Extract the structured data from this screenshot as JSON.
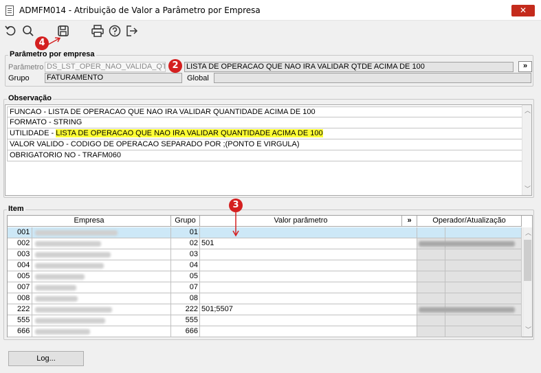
{
  "window": {
    "title": "ADMFM014 - Atribuição de Valor a Parâmetro por Empresa",
    "close_label": "✕"
  },
  "toolbar": {
    "icons": [
      "refresh-icon",
      "search-icon",
      "save-icon",
      "print-icon",
      "help-icon",
      "exit-icon"
    ]
  },
  "markers": [
    "4",
    "2",
    "3"
  ],
  "parametro_empresa": {
    "title": "Parâmetro por empresa",
    "parametro_label": "Parâmetro",
    "parametro_value": "DS_LST_OPER_NAO_VALIDA_QT",
    "descricao_value": "LISTA DE OPERACAO QUE NAO IRA VALIDAR QTDE ACIMA DE 100",
    "expand_label": "»",
    "grupo_label": "Grupo",
    "grupo_value": "FATURAMENTO",
    "global_label": "Global",
    "global_value": ""
  },
  "observacao": {
    "title": "Observação",
    "lines": [
      {
        "prefix": "FUNCAO - LISTA DE OPERACAO QUE NAO IRA VALIDAR QUANTIDADE ACIMA DE 100",
        "highlight": ""
      },
      {
        "prefix": "FORMATO - STRING",
        "highlight": ""
      },
      {
        "prefix": "UTILIDADE - ",
        "highlight": "LISTA DE OPERACAO QUE NAO IRA VALIDAR QUANTIDADE ACIMA DE 100"
      },
      {
        "prefix": "VALOR VALIDO - CODIGO DE OPERACAO SEPARADO POR ;(PONTO E VIRGULA)",
        "highlight": ""
      },
      {
        "prefix": "OBRIGATORIO NO - TRAFM060",
        "highlight": ""
      }
    ]
  },
  "item": {
    "title": "Item",
    "columns": {
      "empresa": "Empresa",
      "grupo": "Grupo",
      "valor": "Valor parâmetro",
      "expand": "»",
      "operador": "Operador/Atualização"
    },
    "rows": [
      {
        "codigo": "001",
        "grupo": "01",
        "valor": "",
        "operador": ""
      },
      {
        "codigo": "002",
        "grupo": "02",
        "valor": "501",
        "operador": "blur"
      },
      {
        "codigo": "003",
        "grupo": "03",
        "valor": "",
        "operador": ""
      },
      {
        "codigo": "004",
        "grupo": "04",
        "valor": "",
        "operador": ""
      },
      {
        "codigo": "005",
        "grupo": "05",
        "valor": "",
        "operador": ""
      },
      {
        "codigo": "007",
        "grupo": "07",
        "valor": "",
        "operador": ""
      },
      {
        "codigo": "008",
        "grupo": "08",
        "valor": "",
        "operador": ""
      },
      {
        "codigo": "222",
        "grupo": "222",
        "valor": "501;5507",
        "operador": "blur"
      },
      {
        "codigo": "555",
        "grupo": "555",
        "valor": "",
        "operador": ""
      },
      {
        "codigo": "666",
        "grupo": "666",
        "valor": "",
        "operador": ""
      }
    ]
  },
  "log_button": "Log...",
  "colors": {
    "marker": "#d42020",
    "highlight": "#ffff33",
    "selected_row": "#cde8f7",
    "close": "#c42b1c"
  }
}
